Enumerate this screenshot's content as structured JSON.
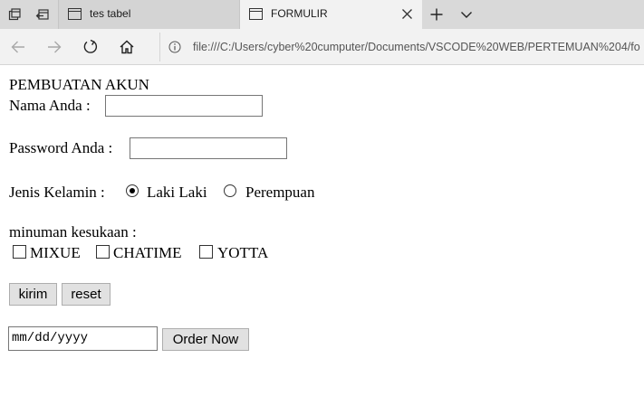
{
  "browser": {
    "tabs": [
      {
        "title": "tes tabel",
        "active": false
      },
      {
        "title": "FORMULIR",
        "active": true
      }
    ],
    "address_url": "file:///C:/Users/cyber%20cumputer/Documents/VSCODE%20WEB/PERTEMUAN%204/fo"
  },
  "form": {
    "heading": "PEMBUATAN AKUN",
    "name_label": "Nama Anda :",
    "name_value": "",
    "password_label": "Password Anda :",
    "password_value": "",
    "gender_label": "Jenis Kelamin :",
    "gender_options": [
      {
        "label": "Laki Laki",
        "checked": true
      },
      {
        "label": "Perempuan",
        "checked": false
      }
    ],
    "drink_label": "minuman kesukaan :",
    "drink_options": [
      {
        "label": "MIXUE",
        "checked": false
      },
      {
        "label": "CHATIME",
        "checked": false
      },
      {
        "label": "YOTTA",
        "checked": false
      }
    ],
    "submit_label": "kirim",
    "reset_label": "reset",
    "date_placeholder": "mm/dd/yyyy",
    "order_label": "Order Now"
  }
}
